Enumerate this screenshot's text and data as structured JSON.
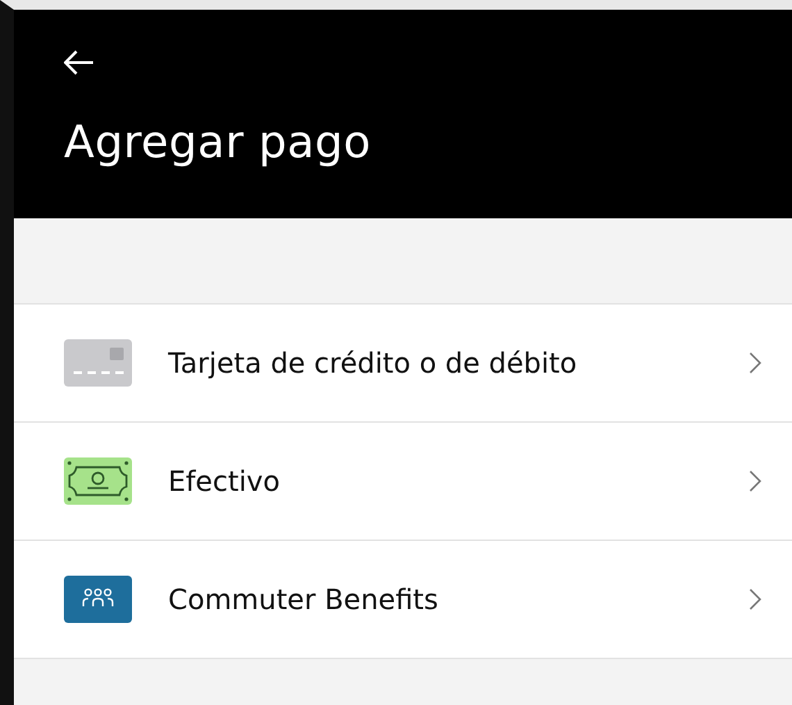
{
  "header": {
    "title": "Agregar pago"
  },
  "payment_methods": [
    {
      "kind": "card",
      "label": "Tarjeta de crédito o de débito"
    },
    {
      "kind": "cash",
      "label": "Efectivo"
    },
    {
      "kind": "commuter",
      "label": "Commuter Benefits"
    }
  ]
}
